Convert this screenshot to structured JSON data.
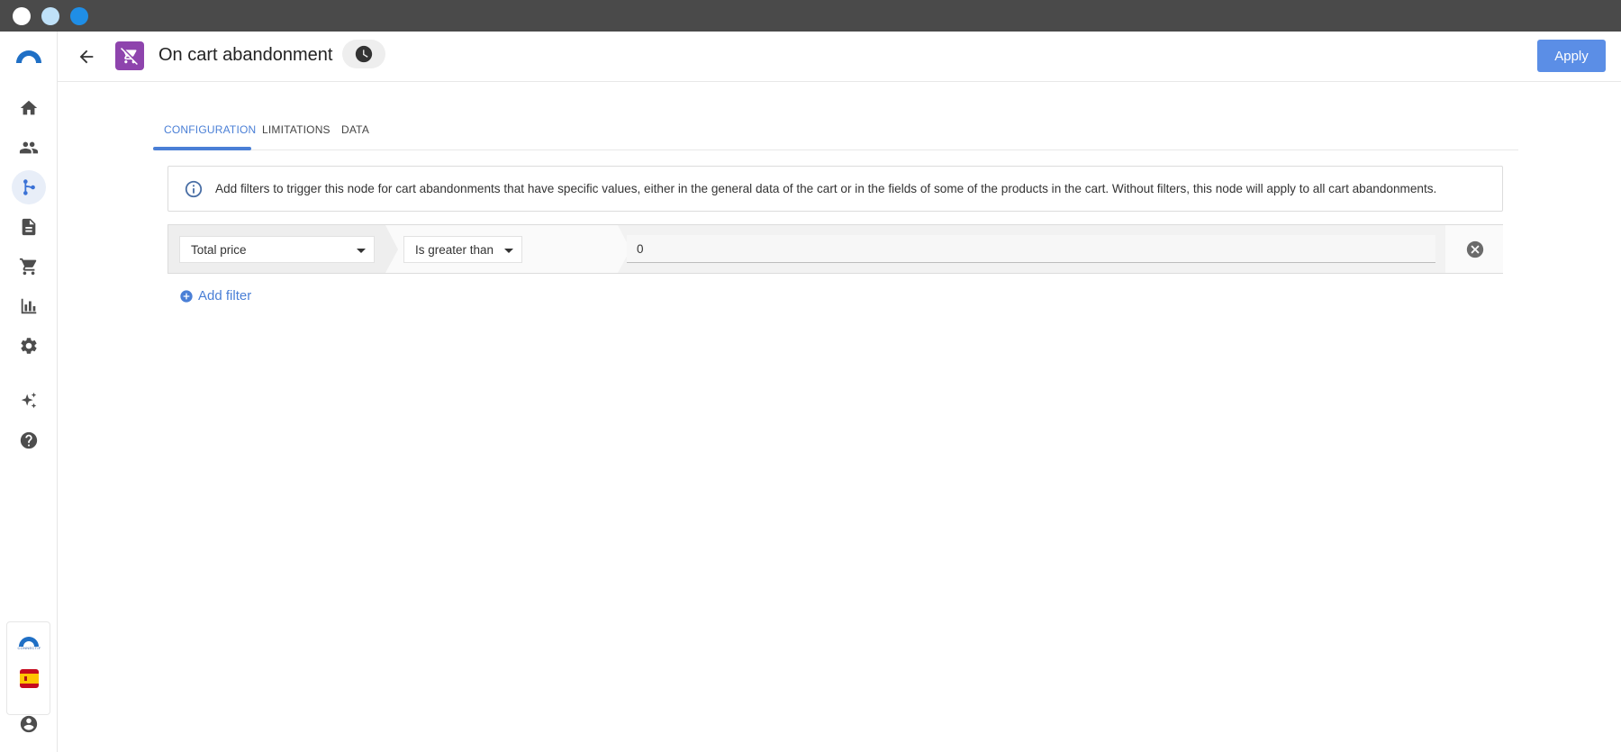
{
  "window": {
    "controls": [
      "close",
      "minimize",
      "maximize"
    ]
  },
  "sidebar": {
    "items": [
      {
        "icon": "home-icon"
      },
      {
        "icon": "users-icon"
      },
      {
        "icon": "workflow-icon",
        "active": true
      },
      {
        "icon": "document-icon"
      },
      {
        "icon": "cart-icon"
      },
      {
        "icon": "bar-chart-icon"
      },
      {
        "icon": "gear-icon"
      },
      {
        "icon": "sparkles-icon"
      },
      {
        "icon": "help-icon"
      }
    ],
    "brand_text": "CONNECTIF",
    "language_flag": "spain-flag-icon",
    "account_icon": "account-icon"
  },
  "header": {
    "title": "On cart abandonment",
    "apply_label": "Apply",
    "node_color": "#8e44ad"
  },
  "tabs": [
    {
      "label": "CONFIGURATION",
      "active": true
    },
    {
      "label": "LIMITATIONS"
    },
    {
      "label": "DATA"
    }
  ],
  "info": {
    "text": "Add filters to trigger this node for cart abandonments that have specific values, either in the general data of the cart or in the fields of some of the products in the cart. Without filters, this node will apply to all cart abandonments."
  },
  "filters": [
    {
      "field": "Total price",
      "operator": "Is greater than",
      "value": "0"
    }
  ],
  "add_filter_label": "Add filter",
  "colors": {
    "accent": "#4a7fd6",
    "apply_button": "#5b8ee6",
    "titlebar": "#4a4a4a"
  }
}
